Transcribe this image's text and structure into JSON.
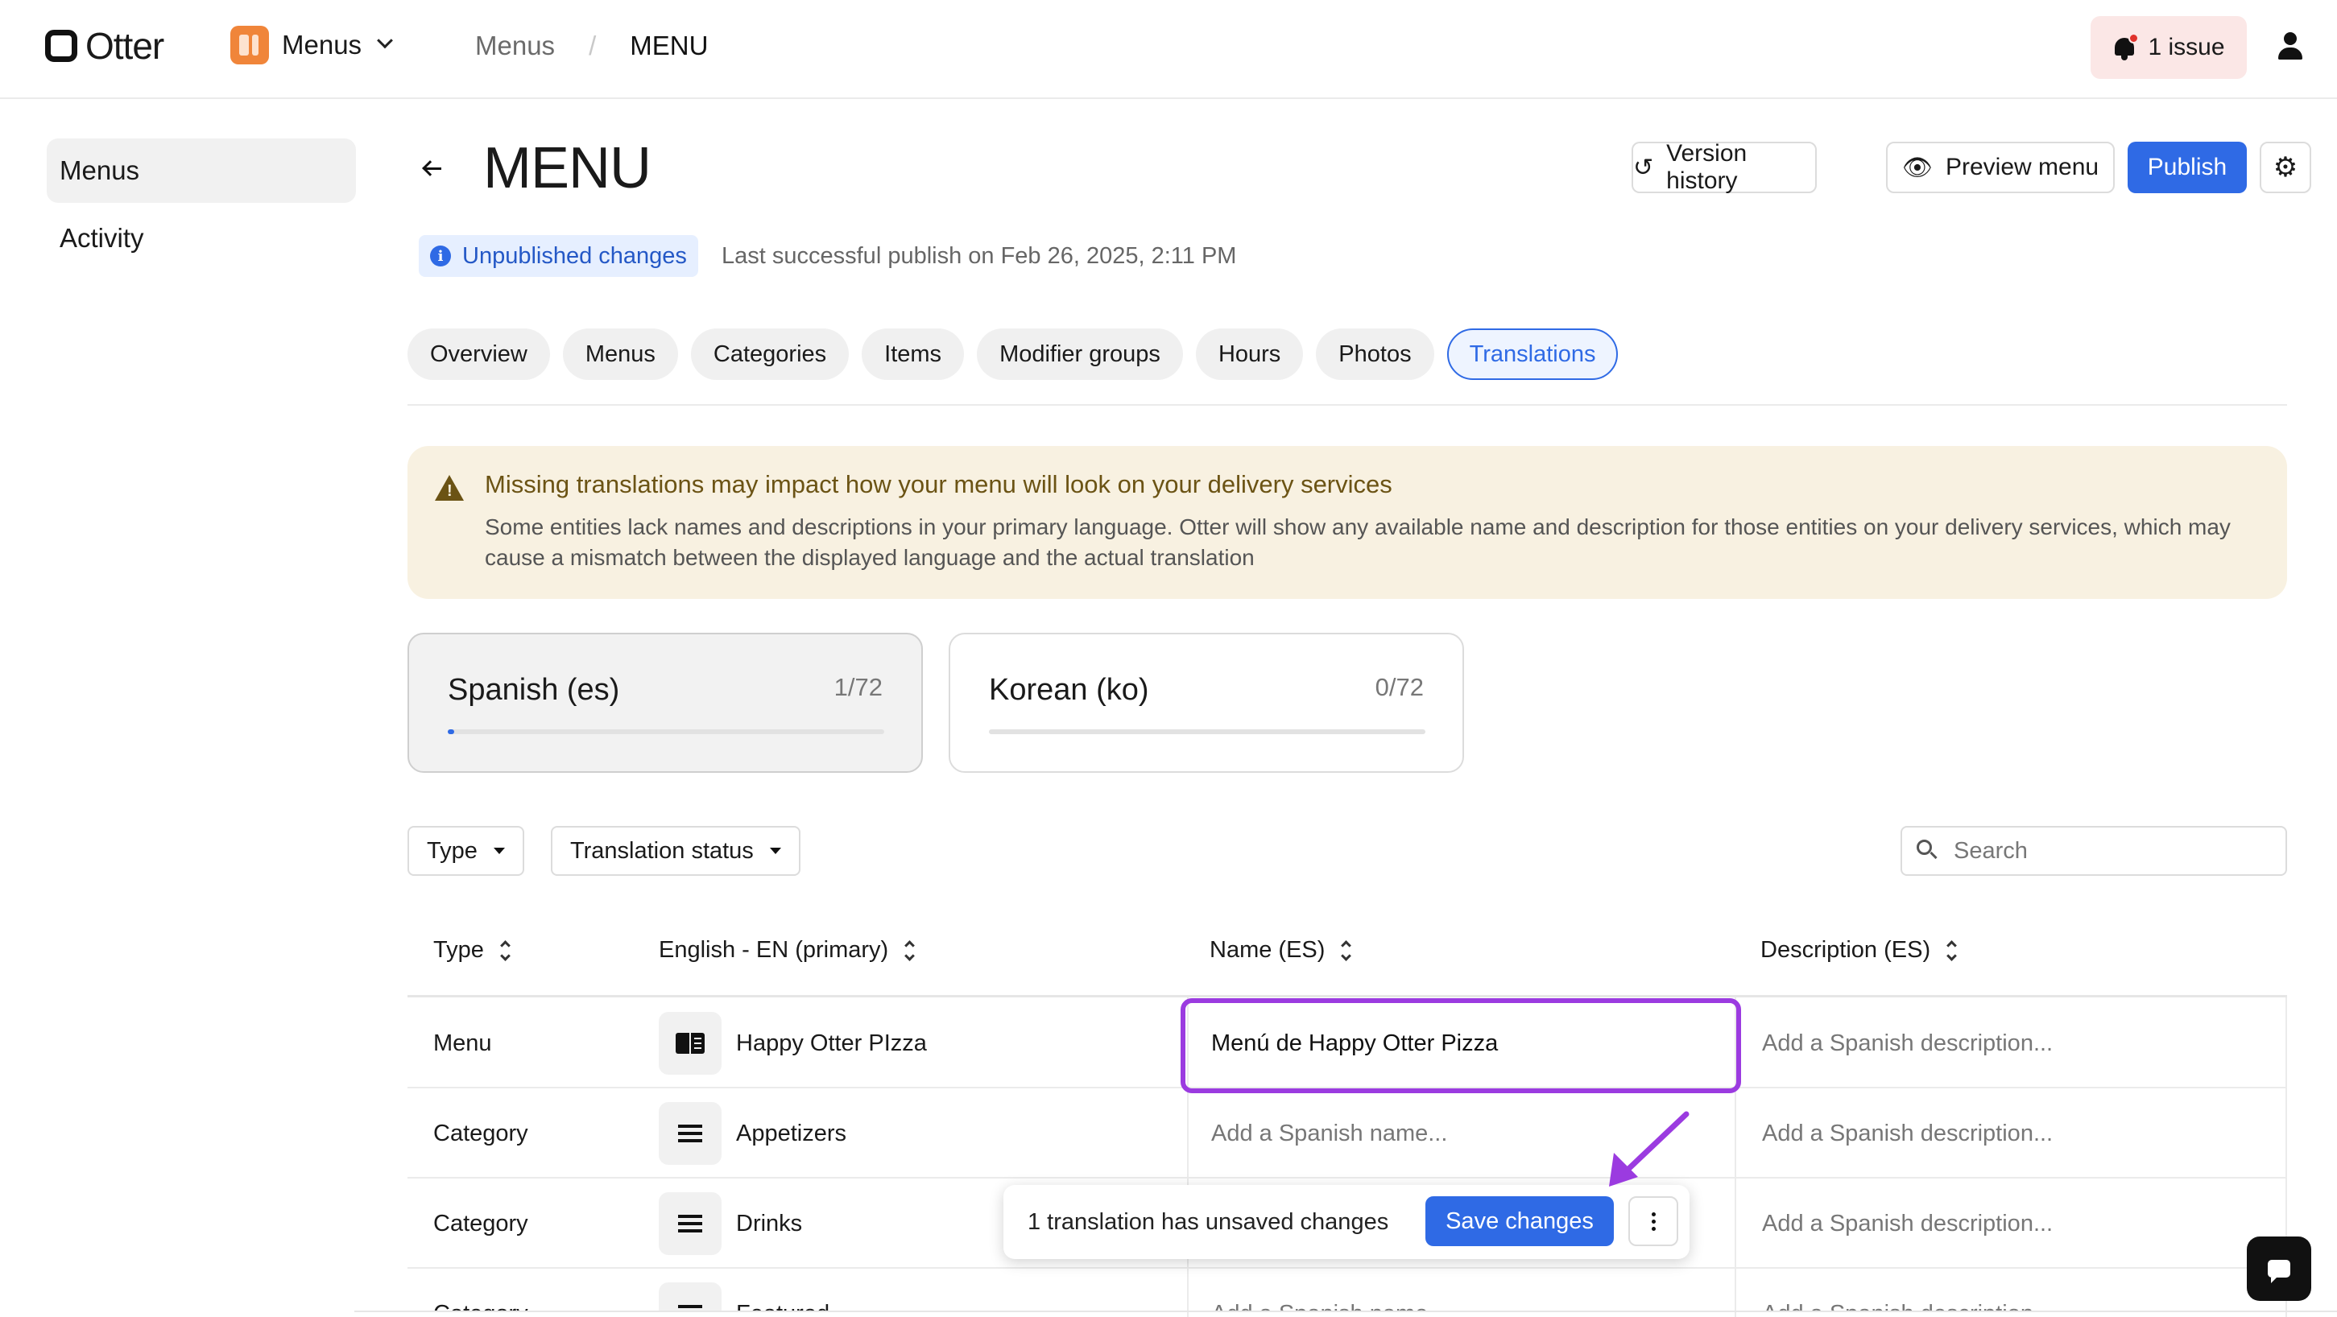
{
  "app": {
    "brand": "Otter",
    "switcher_label": "Menus",
    "issue_label": "1 issue"
  },
  "breadcrumb": {
    "parent": "Menus",
    "separator": "/",
    "current": "MENU"
  },
  "sidebar": {
    "items": [
      {
        "label": "Menus",
        "active": true
      },
      {
        "label": "Activity",
        "active": false
      }
    ]
  },
  "header": {
    "title": "MENU",
    "version_history": "Version history",
    "preview_menu": "Preview menu",
    "publish": "Publish",
    "status_badge": "Unpublished changes",
    "publish_note": "Last successful publish on Feb 26, 2025, 2:11 PM"
  },
  "tabs": [
    {
      "label": "Overview",
      "active": false
    },
    {
      "label": "Menus",
      "active": false
    },
    {
      "label": "Categories",
      "active": false
    },
    {
      "label": "Items",
      "active": false
    },
    {
      "label": "Modifier groups",
      "active": false
    },
    {
      "label": "Hours",
      "active": false
    },
    {
      "label": "Photos",
      "active": false
    },
    {
      "label": "Translations",
      "active": true
    }
  ],
  "warning": {
    "title": "Missing translations may impact how your menu will look on your delivery services",
    "body": "Some entities lack names and descriptions in your primary language. Otter will show any available name and description for those entities on your delivery services, which may cause a mismatch between the displayed language and the actual translation"
  },
  "languages": [
    {
      "name": "Spanish (es)",
      "count": "1/72",
      "done": 1,
      "total": 72,
      "active": true
    },
    {
      "name": "Korean (ko)",
      "count": "0/72",
      "done": 0,
      "total": 72,
      "active": false
    }
  ],
  "filters": {
    "type": "Type",
    "status": "Translation status",
    "search_placeholder": "Search"
  },
  "table": {
    "headers": [
      "Type",
      "English - EN (primary)",
      "Name (ES)",
      "Description (ES)"
    ],
    "name_placeholder": "Add a Spanish name...",
    "description_placeholder": "Add a Spanish description...",
    "rows": [
      {
        "type": "Menu",
        "english": "Happy Otter PIzza",
        "name_es": "Menú de Happy Otter Pizza",
        "icon": "book-icon"
      },
      {
        "type": "Category",
        "english": "Appetizers",
        "name_es": "",
        "icon": "list-icon"
      },
      {
        "type": "Category",
        "english": "Drinks",
        "name_es": "",
        "icon": "list-icon"
      },
      {
        "type": "Category",
        "english": "Featured",
        "name_es": "",
        "icon": "list-icon"
      }
    ]
  },
  "toast": {
    "message": "1 translation has unsaved changes",
    "save": "Save changes"
  },
  "colors": {
    "accent": "#2f6ae5",
    "annotation": "#9b3be0",
    "warning_bg": "#f8f1e1",
    "warning_text": "#6b5314",
    "issue_bg": "#fbe7e6"
  }
}
